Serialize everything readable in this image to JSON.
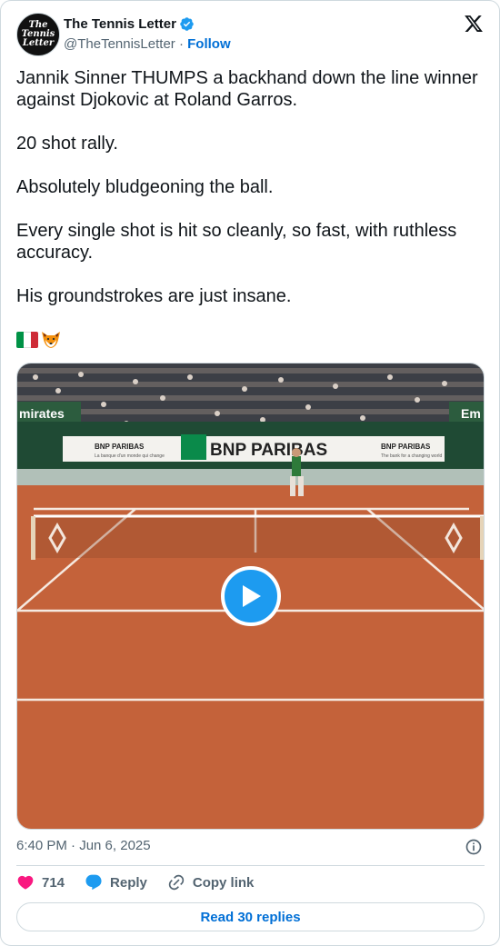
{
  "author": {
    "name": "The Tennis Letter",
    "handle": "@TheTennisLetter",
    "follow_label": "Follow",
    "avatar_lines": [
      "The",
      "Tennis",
      "Letter"
    ],
    "verified": true
  },
  "post": {
    "text": "Jannik Sinner THUMPS a backhand down the line winner against Djokovic at Roland Garros.\n\n20 shot rally.\n\nAbsolutely bludgeoning the ball.\n\nEvery single shot is hit so cleanly, so fast, with ruthless accuracy.\n\nHis groundstrokes are just insane.",
    "emojis": [
      "italy-flag",
      "fox-face"
    ],
    "timestamp": "6:40 PM · Jun 6, 2025"
  },
  "media": {
    "type": "video",
    "banner_left": "mirates",
    "banner_right": "Em",
    "sponsor_main": "BNP PARIBAS",
    "sponsor_small": "BNP PARIBAS",
    "sponsor_tag_left": "La banque d'un monde qui change",
    "sponsor_tag_right": "The bank for a changing world"
  },
  "actions": {
    "like_count": "714",
    "reply_label": "Reply",
    "copy_label": "Copy link",
    "read_replies_label": "Read 30 replies"
  },
  "colors": {
    "accent": "#1d9bf0",
    "link": "#006fd6",
    "like": "#f91880",
    "muted": "#536471",
    "clay": "#c4623a"
  }
}
